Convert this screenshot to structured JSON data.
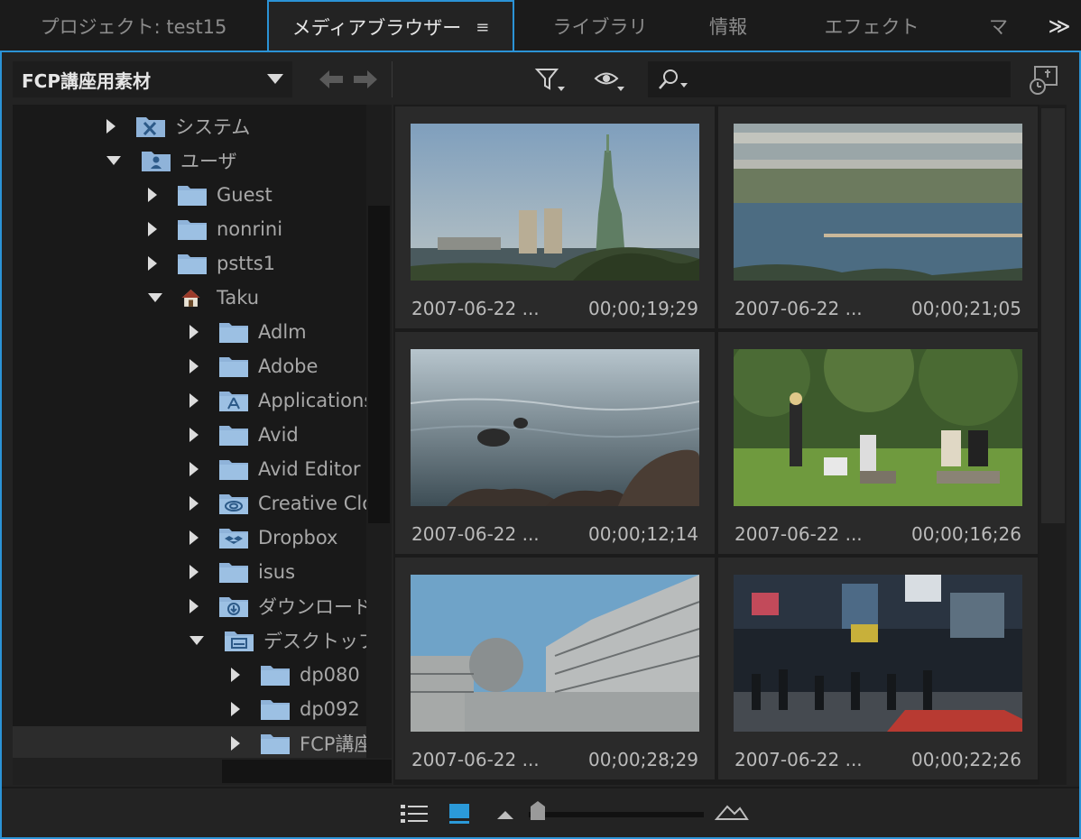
{
  "tabs": [
    {
      "label": "プロジェクト: test15",
      "active": false
    },
    {
      "label": "メディアブラウザー",
      "active": true
    },
    {
      "label": "ライブラリ",
      "active": false
    },
    {
      "label": "情報",
      "active": false
    },
    {
      "label": "エフェクト",
      "active": false
    },
    {
      "label": "マ",
      "active": false
    }
  ],
  "tab_overflow_label": "≫",
  "toolbar": {
    "location": "FCP講座用素材",
    "search_placeholder": ""
  },
  "tree": [
    {
      "label": "システム",
      "indent": 1,
      "expanded": false,
      "icon": "system-folder-icon"
    },
    {
      "label": "ユーザ",
      "indent": 1,
      "expanded": true,
      "icon": "users-folder-icon"
    },
    {
      "label": "Guest",
      "indent": 2,
      "expanded": false,
      "icon": "folder-icon"
    },
    {
      "label": "nonrini",
      "indent": 2,
      "expanded": false,
      "icon": "folder-icon"
    },
    {
      "label": "pstts1",
      "indent": 2,
      "expanded": false,
      "icon": "folder-icon"
    },
    {
      "label": "Taku",
      "indent": 2,
      "expanded": true,
      "icon": "home-icon"
    },
    {
      "label": "Adlm",
      "indent": 3,
      "expanded": false,
      "icon": "folder-icon"
    },
    {
      "label": "Adobe",
      "indent": 3,
      "expanded": false,
      "icon": "folder-icon"
    },
    {
      "label": "Applications",
      "indent": 3,
      "expanded": false,
      "icon": "applications-folder-icon"
    },
    {
      "label": "Avid",
      "indent": 3,
      "expanded": false,
      "icon": "folder-icon"
    },
    {
      "label": "Avid Editor",
      "indent": 3,
      "expanded": false,
      "icon": "folder-icon"
    },
    {
      "label": "Creative Cloud",
      "indent": 3,
      "expanded": false,
      "icon": "creative-cloud-folder-icon"
    },
    {
      "label": "Dropbox",
      "indent": 3,
      "expanded": false,
      "icon": "dropbox-folder-icon"
    },
    {
      "label": "isus",
      "indent": 3,
      "expanded": false,
      "icon": "folder-icon"
    },
    {
      "label": "ダウンロード",
      "indent": 3,
      "expanded": false,
      "icon": "downloads-folder-icon"
    },
    {
      "label": "デスクトップ",
      "indent": 3,
      "expanded": true,
      "icon": "desktop-folder-icon"
    },
    {
      "label": "dp080",
      "indent": 4,
      "expanded": false,
      "icon": "folder-icon"
    },
    {
      "label": "dp092",
      "indent": 4,
      "expanded": false,
      "icon": "folder-icon"
    },
    {
      "label": "FCP講座用素材",
      "indent": 4,
      "expanded": false,
      "icon": "folder-icon",
      "selected": true
    }
  ],
  "clips": [
    {
      "name": "2007-06-22 ...",
      "duration": "00;00;19;29",
      "scene": "statue"
    },
    {
      "name": "2007-06-22 ...",
      "duration": "00;00;21;05",
      "scene": "bay-bridge"
    },
    {
      "name": "2007-06-22 ...",
      "duration": "00;00;12;14",
      "scene": "water-rocks"
    },
    {
      "name": "2007-06-22 ...",
      "duration": "00;00;16;26",
      "scene": "park-people"
    },
    {
      "name": "2007-06-22 ...",
      "duration": "00;00;28;29",
      "scene": "fuji-tv-building"
    },
    {
      "name": "2007-06-22 ...",
      "duration": "00;00;22;26",
      "scene": "shibuya-night"
    }
  ],
  "colors": {
    "accent": "#2b93d6",
    "panel": "#232323",
    "folder": "#8fb3d9"
  }
}
